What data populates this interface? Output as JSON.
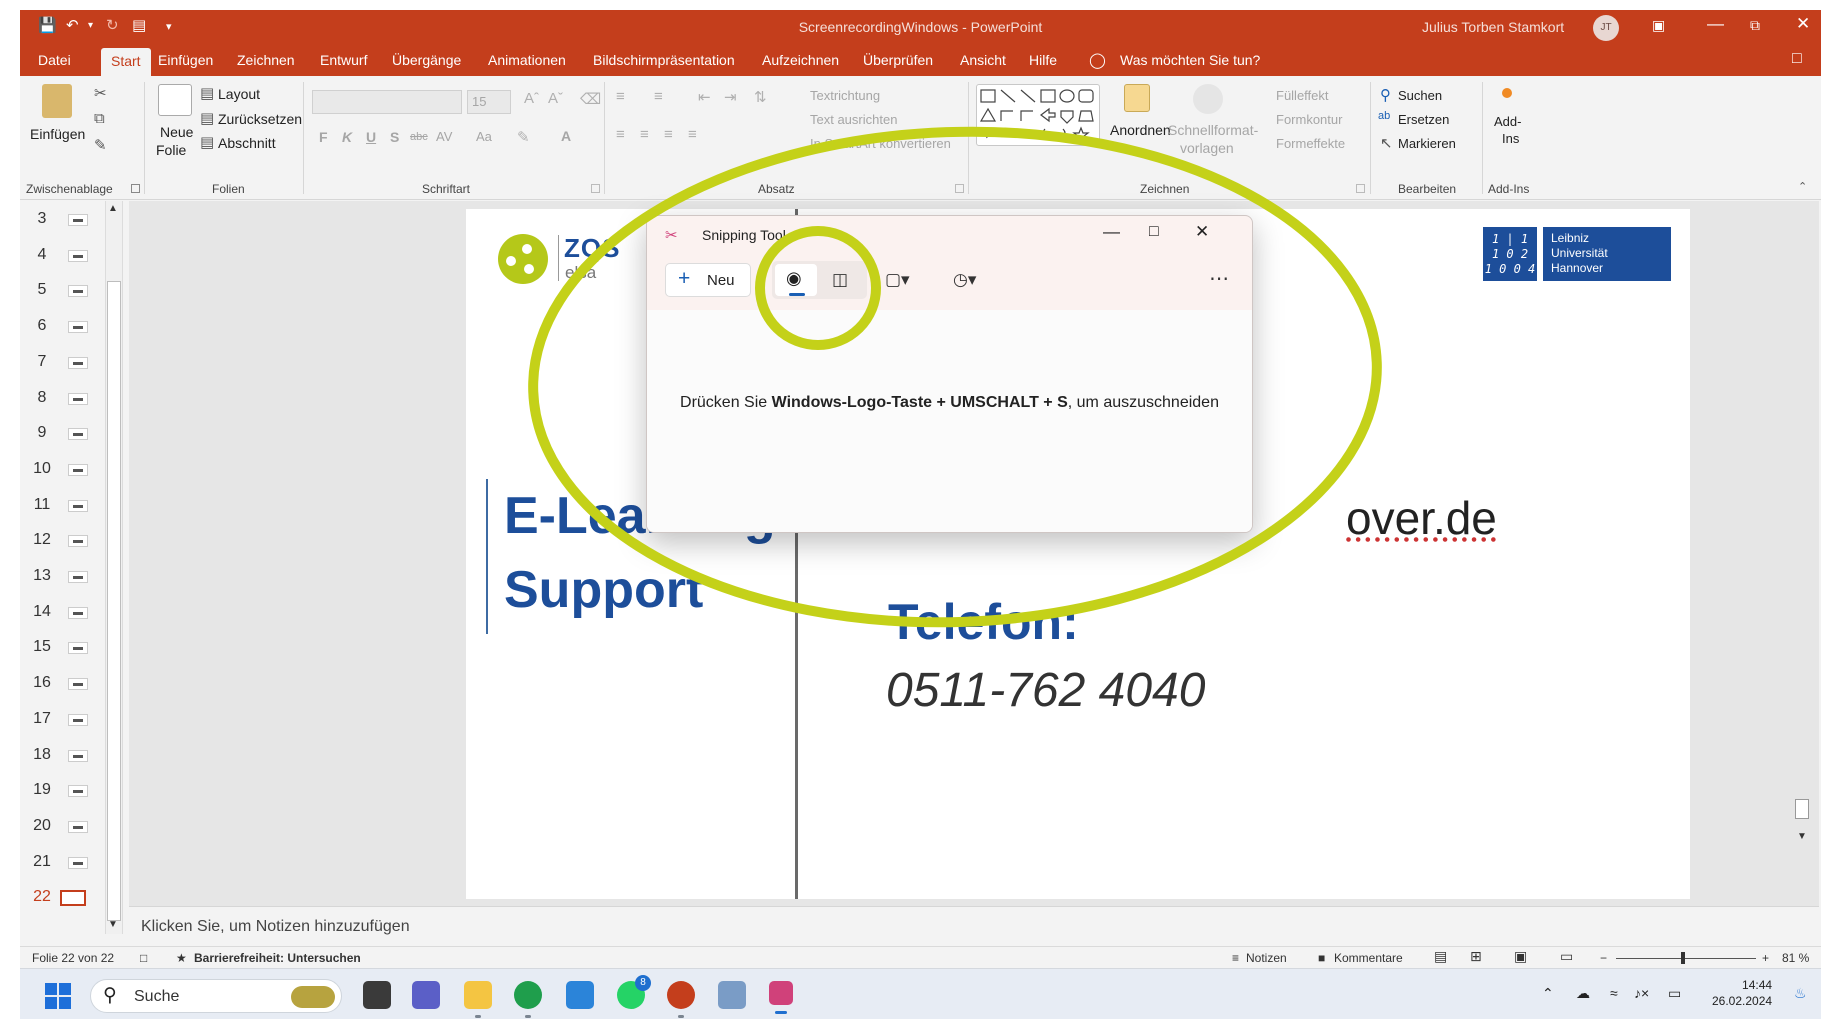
{
  "window": {
    "title": "ScreenrecordingWindows  -  PowerPoint",
    "user_name": "Julius Torben Stamkort",
    "user_initials": "JT"
  },
  "menu": {
    "tabs": [
      "Datei",
      "Start",
      "Einfügen",
      "Zeichnen",
      "Entwurf",
      "Übergänge",
      "Animationen",
      "Bildschirmpräsentation",
      "Aufzeichnen",
      "Überprüfen",
      "Ansicht",
      "Hilfe"
    ],
    "active_tab": "Start",
    "tell_me": "Was möchten Sie tun?"
  },
  "ribbon": {
    "clipboard": {
      "paste": "Einfügen",
      "group": "Zwischenablage"
    },
    "slides": {
      "new_slide_1": "Neue",
      "new_slide_2": "Folie",
      "layout": "Layout",
      "reset": "Zurücksetzen",
      "section": "Abschnitt",
      "group": "Folien"
    },
    "font": {
      "size": "15",
      "bold": "F",
      "italic": "K",
      "underline": "U",
      "strike": "S",
      "strike2": "abc",
      "spacing": "AV",
      "case": "Aa",
      "color": "A",
      "group": "Schriftart"
    },
    "paragraph": {
      "direction": "Textrichtung",
      "align": "Text ausrichten",
      "smartart": "In SmartArt konvertieren",
      "group": "Absatz"
    },
    "drawing": {
      "arrange": "Anordnen",
      "quickstyles_1": "Schnellformat-",
      "quickstyles_2": "vorlagen",
      "fill": "Fülleffekt",
      "outline": "Formkontur",
      "effects": "Formeffekte",
      "group": "Zeichnen"
    },
    "editing": {
      "find": "Suchen",
      "replace": "Ersetzen",
      "select": "Markieren",
      "group": "Bearbeiten"
    },
    "addins": {
      "label_1": "Add-",
      "label_2": "Ins",
      "group": "Add-Ins"
    }
  },
  "slide_panel": {
    "numbers": [
      "3",
      "4",
      "5",
      "6",
      "7",
      "8",
      "9",
      "10",
      "11",
      "12",
      "13",
      "14",
      "15",
      "16",
      "17",
      "18",
      "19",
      "20",
      "21",
      "22"
    ],
    "current": "22"
  },
  "slide": {
    "logo_text": "ZQS",
    "logo_sub": "elsa",
    "heading_1": "E-Learning",
    "heading_2": "Support",
    "email_tail": "over.de",
    "tel_label": "Telefon:",
    "tel_number": "0511-762 4040",
    "luh_mark": [
      "1 | 1",
      "1 0 2",
      "1 0 0 4"
    ],
    "luh_name": [
      "Leibniz",
      "Universität",
      "Hannover"
    ]
  },
  "notes": {
    "placeholder": "Klicken Sie, um Notizen hinzuzufügen"
  },
  "statusbar": {
    "slide_info": "Folie 22 von 22",
    "accessibility": "Barrierefreiheit: Untersuchen",
    "notes": "Notizen",
    "comments": "Kommentare",
    "zoom": "81 %"
  },
  "snipping_tool": {
    "title": "Snipping Tool",
    "new_label": "Neu",
    "message_prefix": "Drücken Sie ",
    "message_keys": "Windows-Logo-Taste + UMSCHALT + S",
    "message_suffix": ", um auszuschneiden"
  },
  "taskbar": {
    "search": "Suche",
    "whatsapp_badge": "8",
    "time": "14:44",
    "date": "26.02.2024"
  },
  "colors": {
    "powerpoint_red": "#c43e1c",
    "annotation_green": "#c4d119",
    "slide_blue": "#1d4e9a"
  }
}
